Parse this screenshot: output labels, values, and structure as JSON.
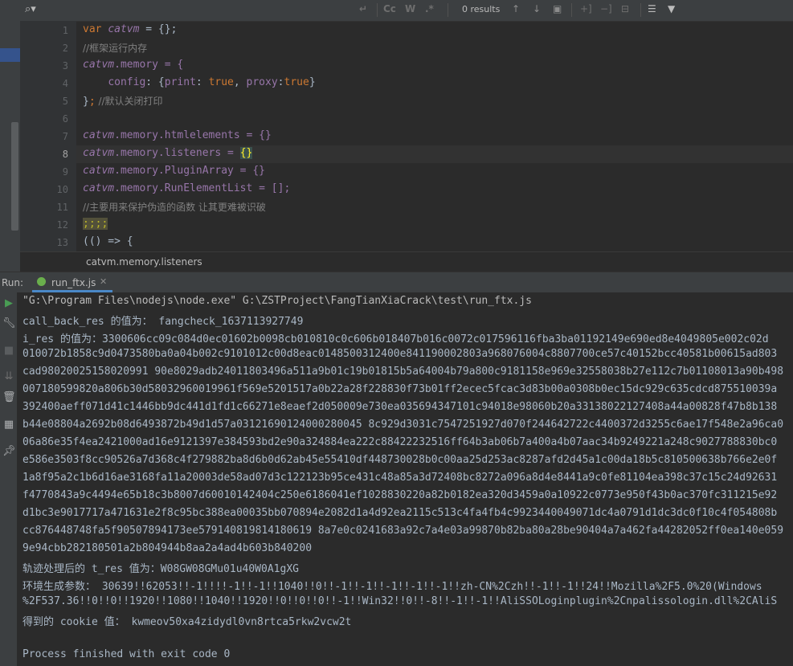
{
  "search": {
    "results": "0 results",
    "tools": [
      "Cc",
      "W",
      ".*"
    ]
  },
  "editor": {
    "line_numbers": [
      "1",
      "2",
      "3",
      "4",
      "5",
      "6",
      "7",
      "8",
      "9",
      "10",
      "11",
      "12",
      "13"
    ],
    "lines": {
      "l1": {
        "kw": "var",
        "name": "catvm",
        "rest": " = {};"
      },
      "l2": {
        "comment": "//框架运行内存"
      },
      "l3": {
        "name": "catvm",
        "rest": ".memory = {"
      },
      "l4": {
        "k1": "config",
        "t1": ": {",
        "k2": "print",
        "t2": ": ",
        "v1": "true",
        "t3": ", ",
        "k3": "proxy",
        "t4": ":",
        "v2": "true",
        "t5": "}"
      },
      "l5": {
        "t1": "}",
        "t2": ";",
        "comment": " //默认关闭打印"
      },
      "l7": {
        "name": "catvm",
        "rest": ".memory.htmlelements = {}"
      },
      "l8": {
        "name": "catvm",
        "rest": ".memory.listeners = ",
        "hl": "{}"
      },
      "l9": {
        "name": "catvm",
        "rest": ".memory.PluginArray = {}"
      },
      "l10": {
        "name": "catvm",
        "rest": ".memory.RunElementList = [];"
      },
      "l11": {
        "comment": "//主要用来保护伪造的函数 让其更难被识破"
      },
      "l12": {
        "warn": ";;;;"
      },
      "l13": {
        "text": "(() => {"
      }
    },
    "breadcrumb": "catvm.memory.listeners"
  },
  "run": {
    "label": "Run:",
    "tab": "run_ftx.js",
    "console": [
      "\"G:\\Program Files\\nodejs\\node.exe\" G:\\ZSTProject\\FangTianXiaCrack\\test\\run_ftx.js",
      "call_back_res 的值为： fangcheck_1637113927749",
      "i_res 的值为：3300606cc09c084d0ec01602b0098cb010810c0c606b018407b016c0072c017596116fba3ba01192149e690ed8e4049805e002c02d",
      "010072b1858c9d0473580ba0a04b002c9101012c00d8eac0148500312400e841190002803a968076004c8807700ce57c40152bcc40581b00615ad803",
      "cad98020025158020991 90e8029adb24011803496a511a9b01c19b01815b5a64004b79a800c9181158e969e32558038b27e112c7b01108013a90b498",
      "007180599820a806b30d58032960019961f569e5201517a0b22a28f228830f73b01ff2ecec5fcac3d83b00a0308b0ec15dc929c635cdcd875510039a",
      "392400aeff071d41c1446bb9dc441d1fd1c66271e8eaef2d050009e730ea035694347101c94018e98060b20a33138022127408a44a00828f47b8b138",
      "b44e08804a2692b08d6493872b49d1d57a03121690124000280045 8c929d3031c7547251927d070f244642722c4400372d3255c6ae17f548e2a96ca0",
      "06a86e35f4ea2421000ad16e9121397e384593bd2e90a324884ea222c88422232516ff64b3ab06b7a400a4b07aac34b9249221a248c9027788830bc0",
      "e586e3503f8cc90526a7d368c4f279882ba8d6b0d62ab45e55410df448730028b0c00aa25d253ac8287afd2d45a1c00da18b5c810500638b766e2e0f",
      "1a8f95a2c1b6d16ae3168fa11a20003de58ad07d3c122123b95ce431c48a85a3d72408bc8272a096a8d4e8441a9c0fe81104ea398c37c15c24d92631",
      "f4770843a9c4494e65b18c3b8007d60010142404c250e6186041ef1028830220a82b0182ea320d3459a0a10922c0773e950f43b0ac370fc311215e92",
      "d1bc3e9017717a471631e2f8c95bc388ea00035bb070894e2082d1a4d92ea2115c513c4fa4fb4c9923440049071dc4a0791d1dc3dc0f10c4f054808b",
      "cc876448748fa5f90507894173ee579140819814180619 8a7e0c0241683a92c7a4e03a99870b82ba80a28be90404a7a462fa44282052ff0ea140e059",
      "9e94cbb282180501a2b804944b8aa2a4ad4b603b840200",
      "轨迹处理后的 t_res 值为：W08GW08GMu01u40W0A1gXG",
      "环境生成参数： 30639!!62053!!-1!!!!-1!!-1!!1040!!0!!-1!!-1!!-1!!-1!!-1!!zh-CN%2Czh!!-1!!-1!!24!!Mozilla%2F5.0%20(Windows",
      "%2F537.36!!0!!0!!1920!!1080!!1040!!1920!!0!!0!!0!!-1!!Win32!!0!!-8!!-1!!-1!!AliSSOLoginplugin%2Cnpalissologin.dll%2CAliS",
      "得到的 cookie 值： kwmeov50xa4zidydl0vn8rtca5rkw2vcw2t",
      "",
      "Process finished with exit code 0"
    ]
  },
  "colors": {
    "accent": "#4a88c7",
    "run_green": "#6aaf4c",
    "keyword": "#cc7832",
    "global_var": "#9876aa",
    "comment": "#808080"
  }
}
